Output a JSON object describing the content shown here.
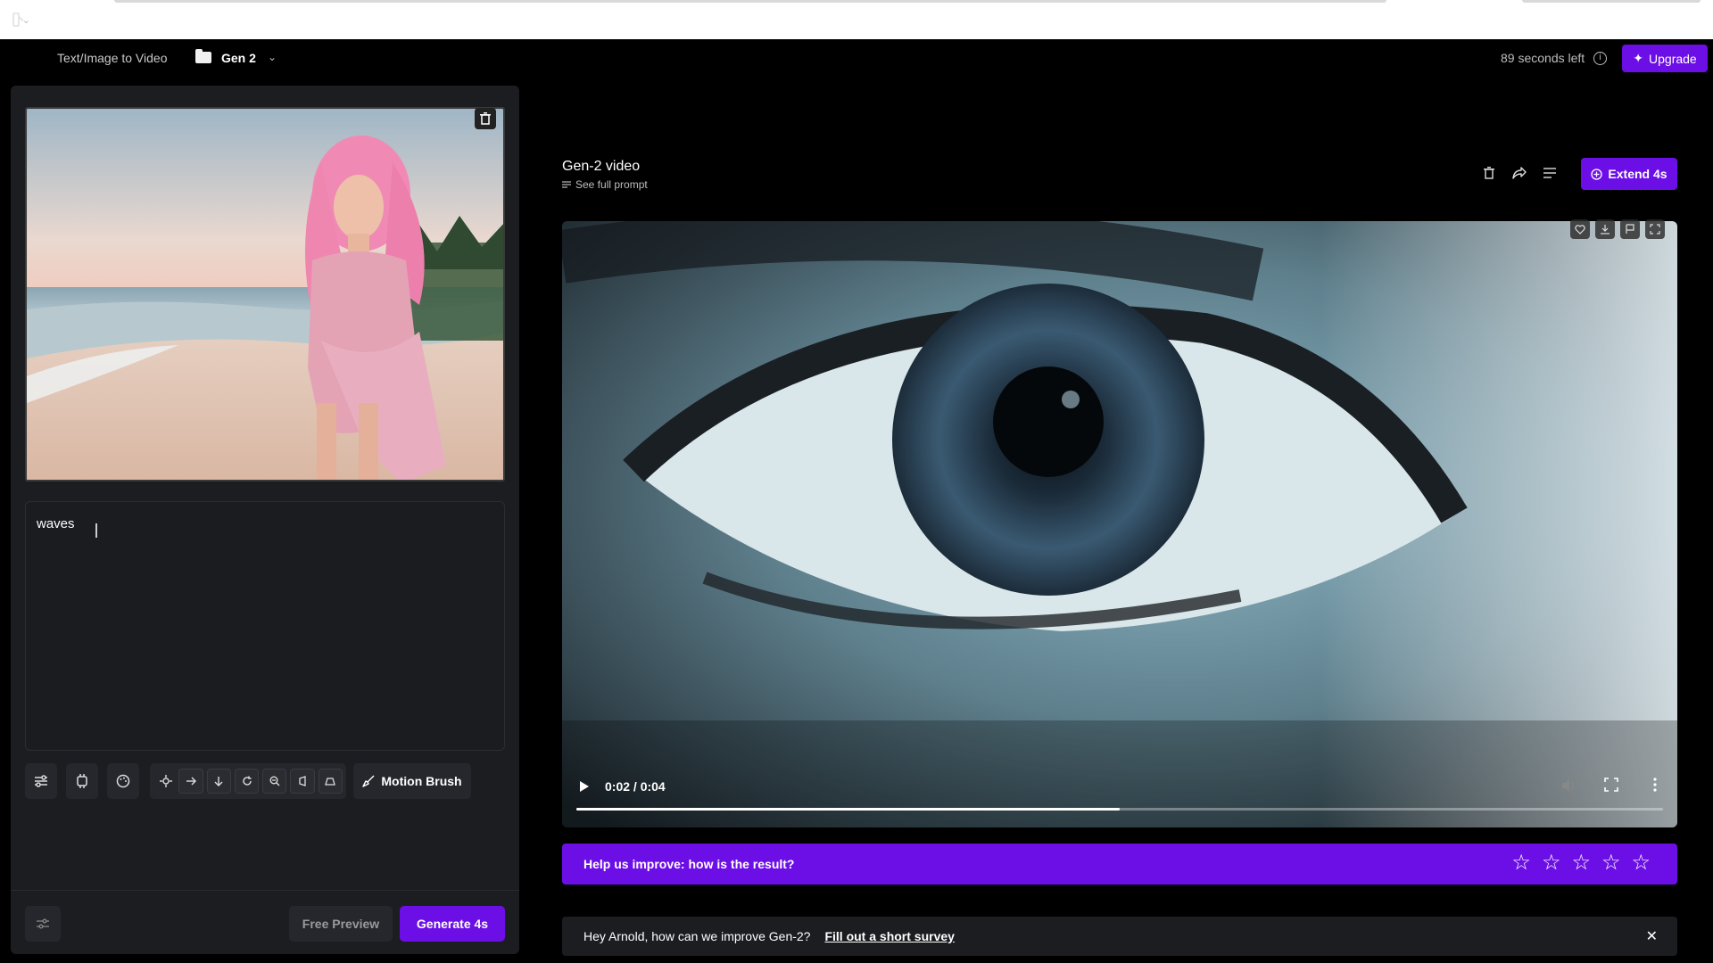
{
  "header": {
    "breadcrumb_tool": "Text/Image to Video",
    "project": "Gen 2",
    "seconds_left": "89 seconds left",
    "upgrade_label": "Upgrade"
  },
  "left": {
    "prompt_text": "waves",
    "motion_brush_label": "Motion Brush",
    "free_preview_label": "Free Preview",
    "generate_label": "Generate 4s"
  },
  "video": {
    "title": "Gen-2 video",
    "see_prompt": "See full prompt",
    "extend_label": "Extend 4s",
    "time": "0:02 / 0:04",
    "progress_fraction": 0.5
  },
  "feedback": {
    "question": "Help us improve: how is the result?"
  },
  "survey": {
    "text": "Hey Arnold, how can we improve Gen-2?",
    "link": "Fill out a short survey"
  },
  "colors": {
    "accent": "#6c0fe6"
  }
}
